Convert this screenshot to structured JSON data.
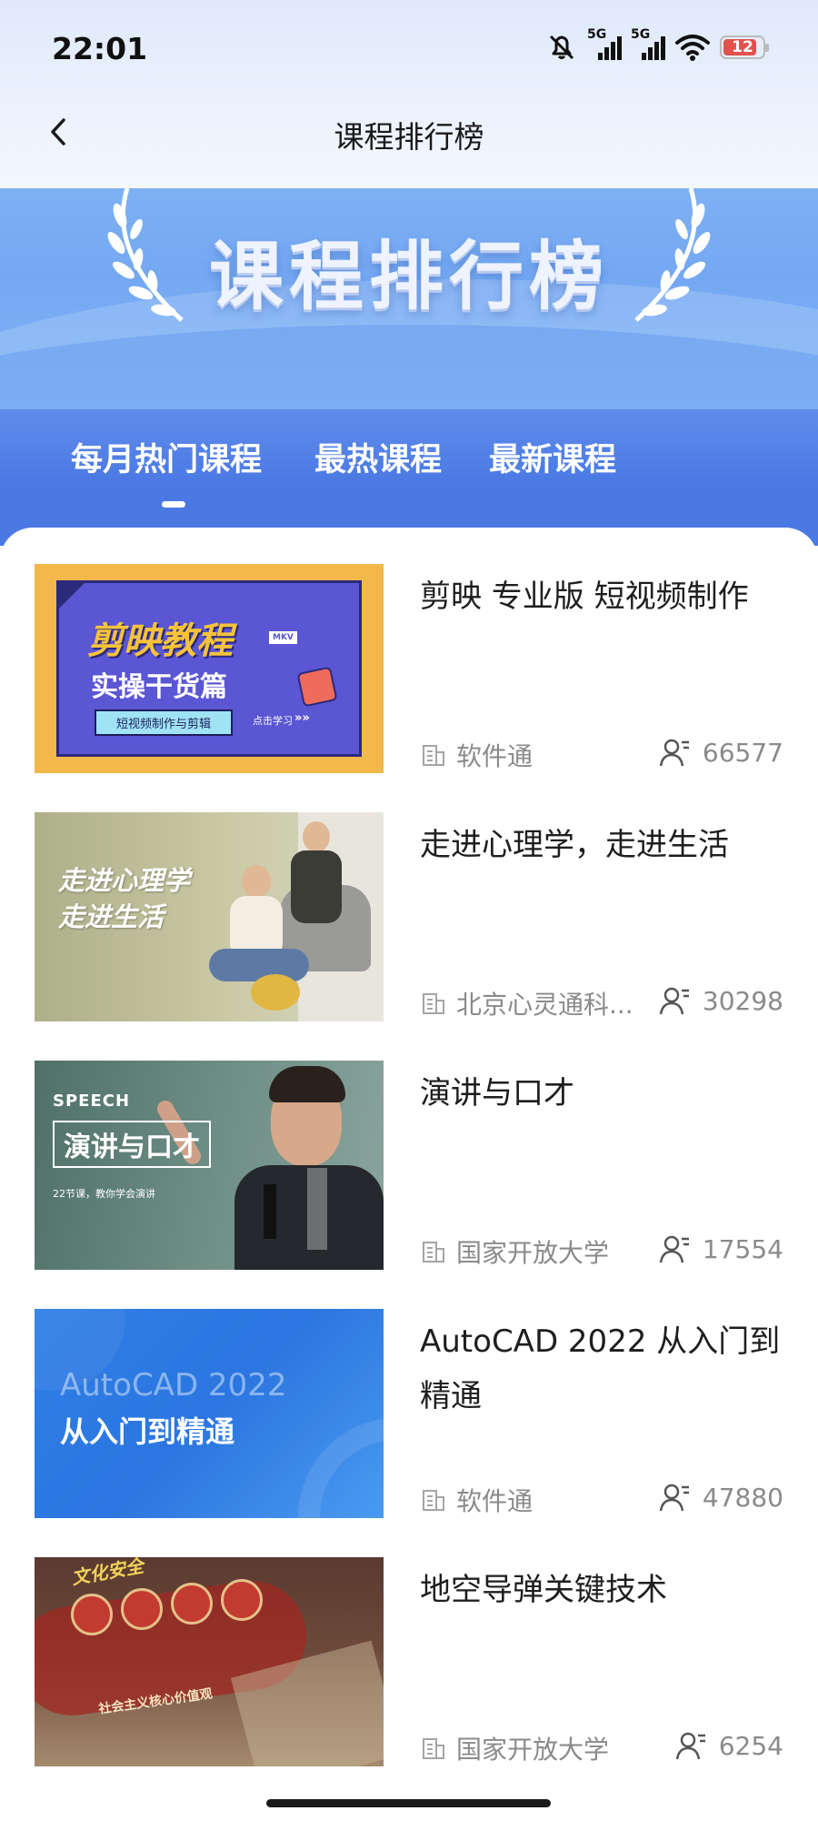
{
  "status_bar": {
    "time": "22:01",
    "network1": "5G",
    "network2": "5G",
    "battery": "12",
    "colors": {
      "battery_low": "#e2514c"
    }
  },
  "nav": {
    "title": "课程排行榜",
    "back_icon": "chevron-left-icon"
  },
  "banner": {
    "title": "课程排行榜"
  },
  "tabs": [
    {
      "label": "每月热门课程",
      "active": true
    },
    {
      "label": "最热课程",
      "active": false
    },
    {
      "label": "最新课程",
      "active": false
    }
  ],
  "courses": [
    {
      "title": "剪映 专业版 短视频制作",
      "org": "软件通",
      "learners": "66577",
      "thumb": {
        "line1": "剪映教程",
        "line2": "实操干货篇",
        "tag": "短视频制作与剪辑",
        "cta": "点击学习",
        "file": "MKV"
      }
    },
    {
      "title": "走进心理学，走进生活",
      "org": "北京心灵通科...",
      "learners": "30298",
      "thumb": {
        "line1": "走进心理学",
        "line2": "走进生活"
      }
    },
    {
      "title": "演讲与口才",
      "org": "国家开放大学",
      "learners": "17554",
      "thumb": {
        "kicker": "SPEECH",
        "line1": "演讲与口才",
        "line2": "22节课，教你学会演讲"
      }
    },
    {
      "title": "AutoCAD 2022 从入门到精通",
      "org": "软件通",
      "learners": "47880",
      "thumb": {
        "line1": "AutoCAD 2022",
        "line2": "从入门到精通"
      }
    },
    {
      "title": "地空导弹关键技术",
      "org": "国家开放大学",
      "learners": "6254",
      "thumb": {
        "line1": "文化安全",
        "line2": "社会主义核心价值观"
      }
    }
  ],
  "colors": {
    "tab_bg": "#4a79e4",
    "banner_bg": "#7db0f3"
  }
}
